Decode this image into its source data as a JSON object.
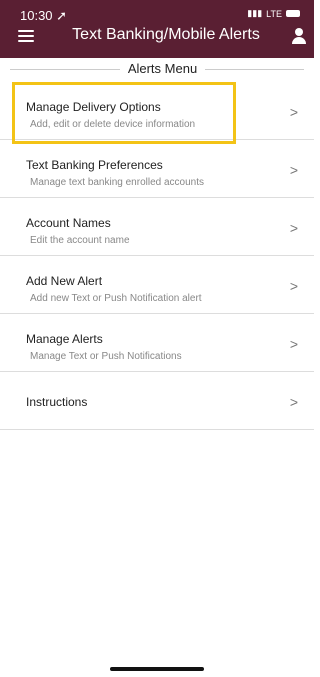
{
  "status": {
    "time": "10:30",
    "network": "LTE",
    "location_icon": "location-arrow-icon",
    "battery_icon": "battery-icon"
  },
  "header": {
    "title": "Text Banking/Mobile Alerts",
    "menu_icon": "hamburger-menu-icon",
    "user_icon": "user-profile-icon",
    "background_color": "#5a1f33"
  },
  "section": {
    "heading": "Alerts Menu"
  },
  "menu_items": [
    {
      "title": "Manage Delivery Options",
      "subtitle": "Add, edit or delete device information"
    },
    {
      "title": "Text Banking Preferences",
      "subtitle": "Manage text banking enrolled accounts"
    },
    {
      "title": "Account Names",
      "subtitle": "Edit the account name"
    },
    {
      "title": "Add New Alert",
      "subtitle": "Add new Text or Push Notification alert"
    },
    {
      "title": "Manage Alerts",
      "subtitle": "Manage Text or Push Notifications"
    },
    {
      "title": "Instructions",
      "subtitle": ""
    }
  ],
  "highlight_color": "#f3c316",
  "chevron_glyph": ">"
}
